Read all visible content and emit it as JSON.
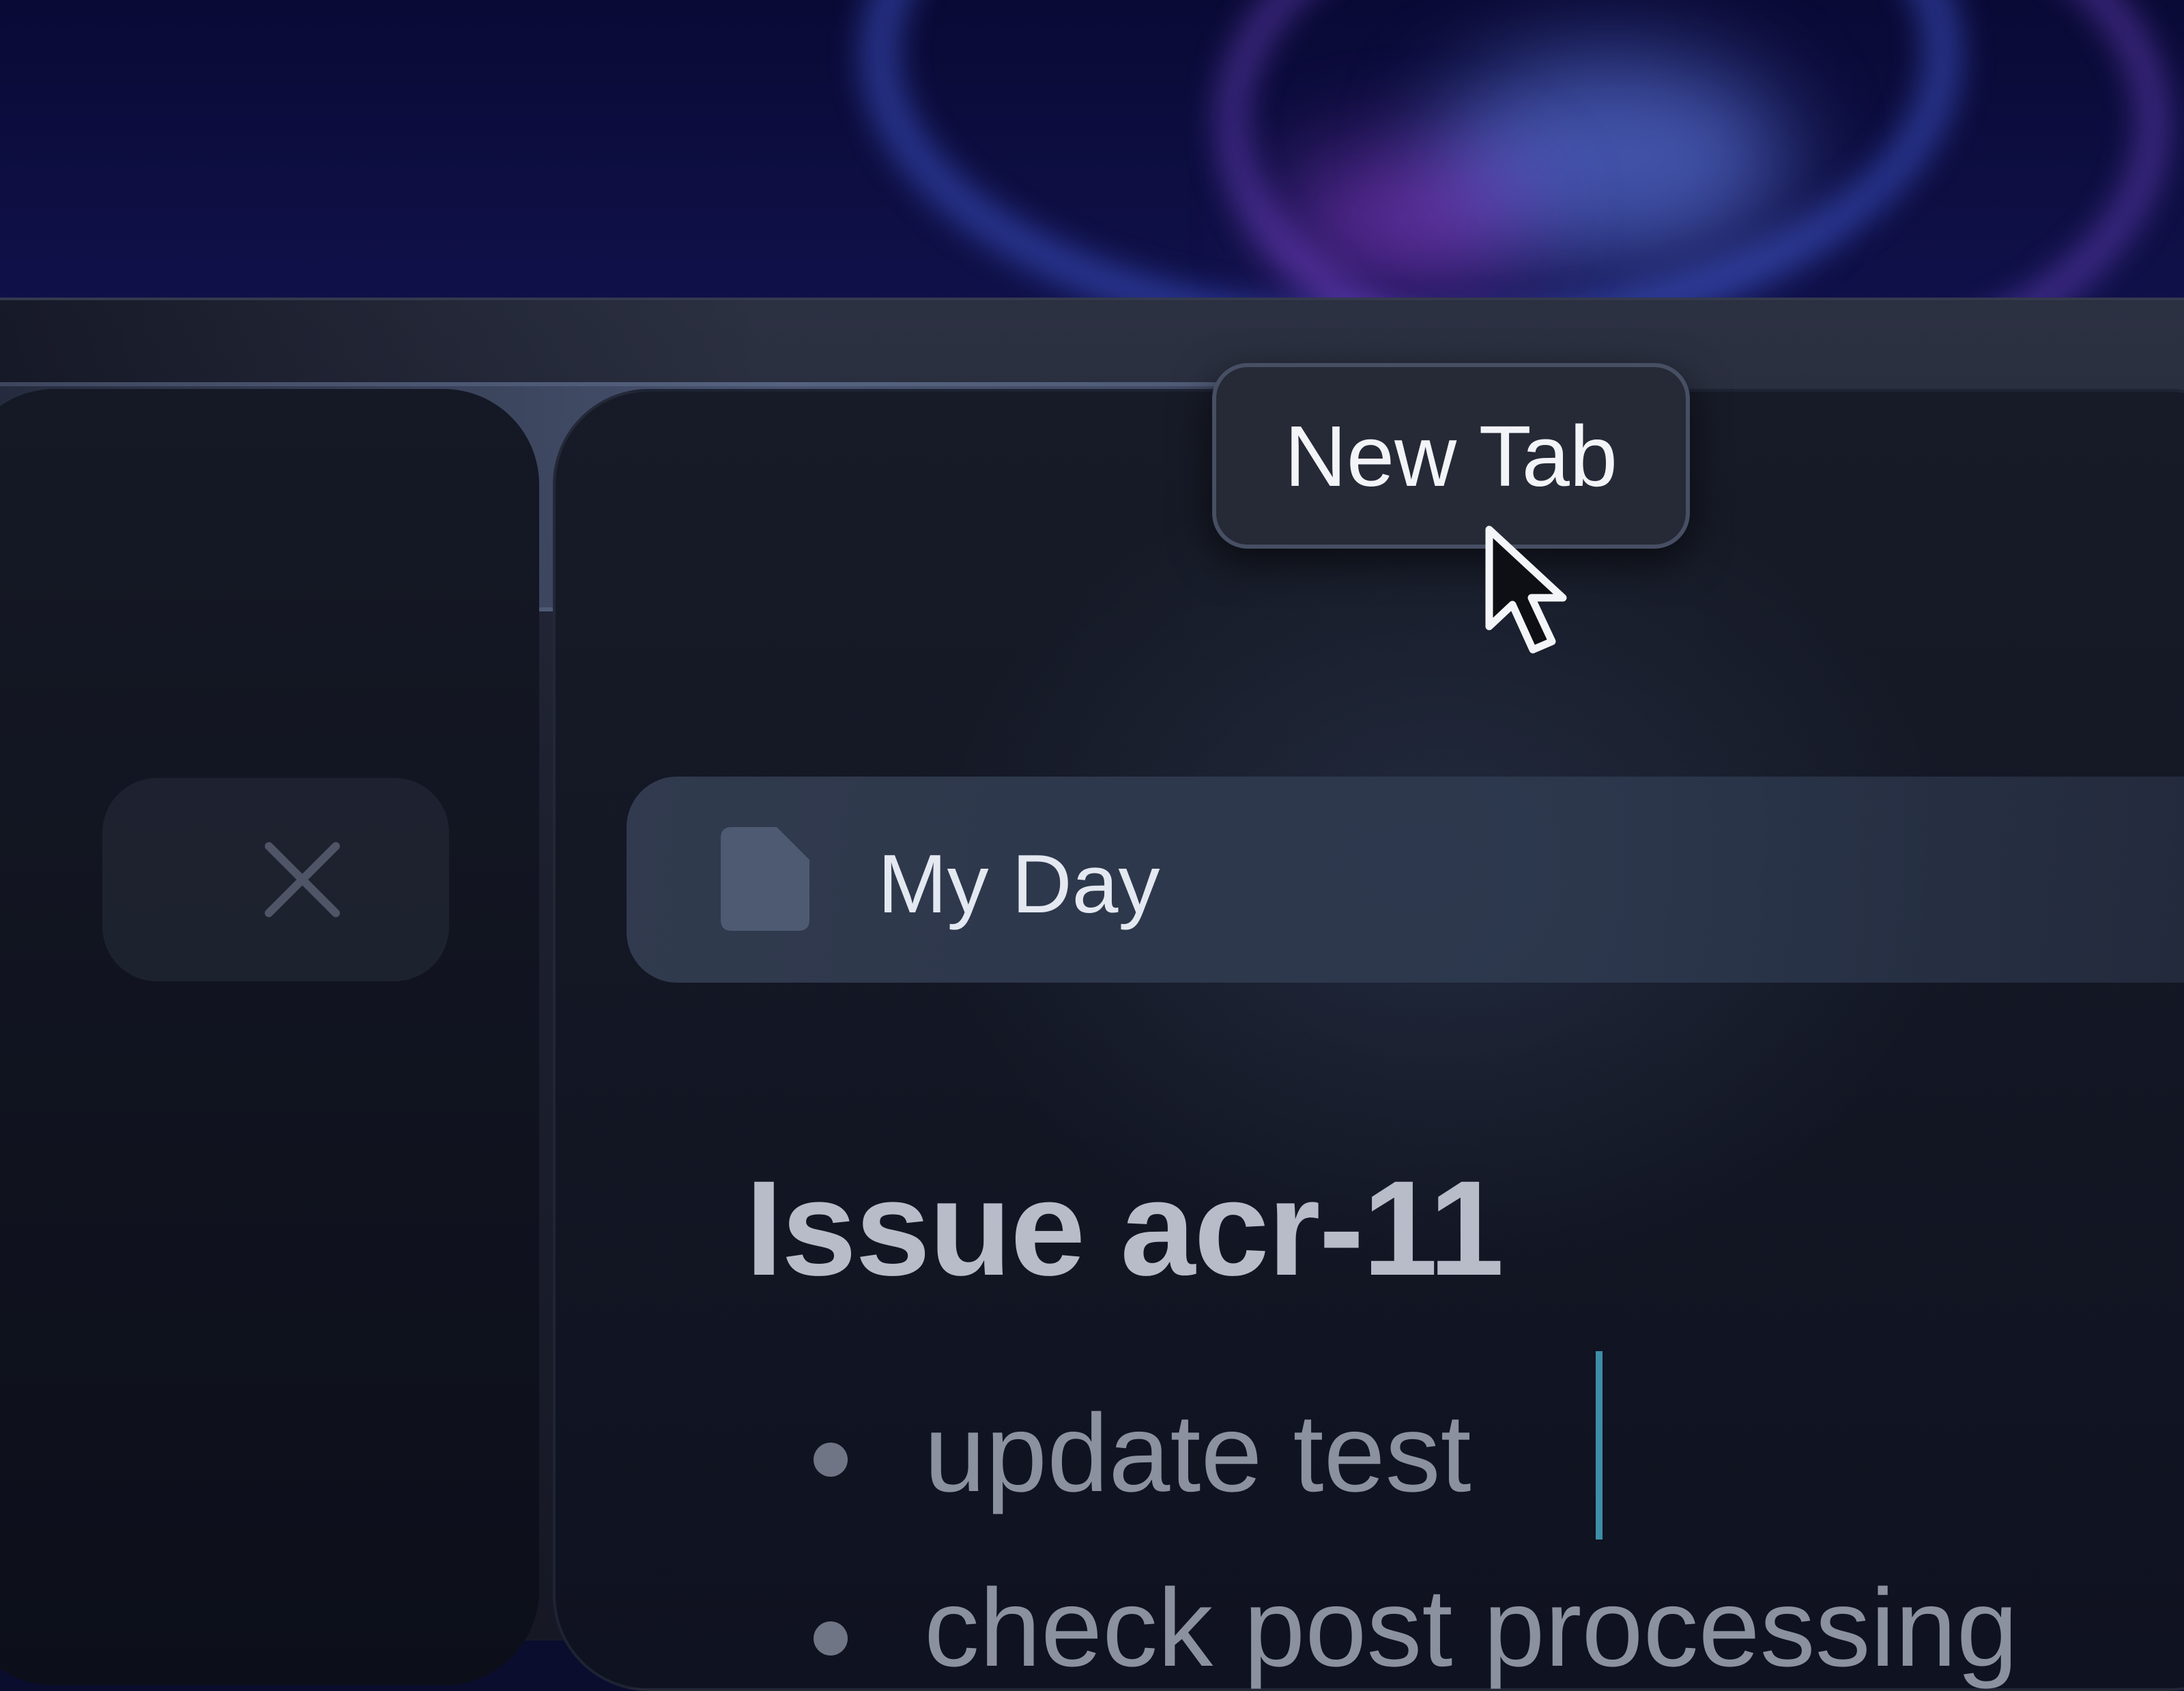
{
  "window": {
    "new_tab_tooltip": "New Tab",
    "new_tab_button_icon": "plus-icon",
    "close_icon": "close-icon"
  },
  "active_tab": {
    "icon": "document-icon",
    "title": "My Day"
  },
  "document": {
    "heading": "Issue acr-11",
    "bullets": [
      "update test",
      "check post processing"
    ]
  },
  "colors": {
    "text_caret": "#3d8ea8",
    "tooltip_bg": "#262a36"
  }
}
